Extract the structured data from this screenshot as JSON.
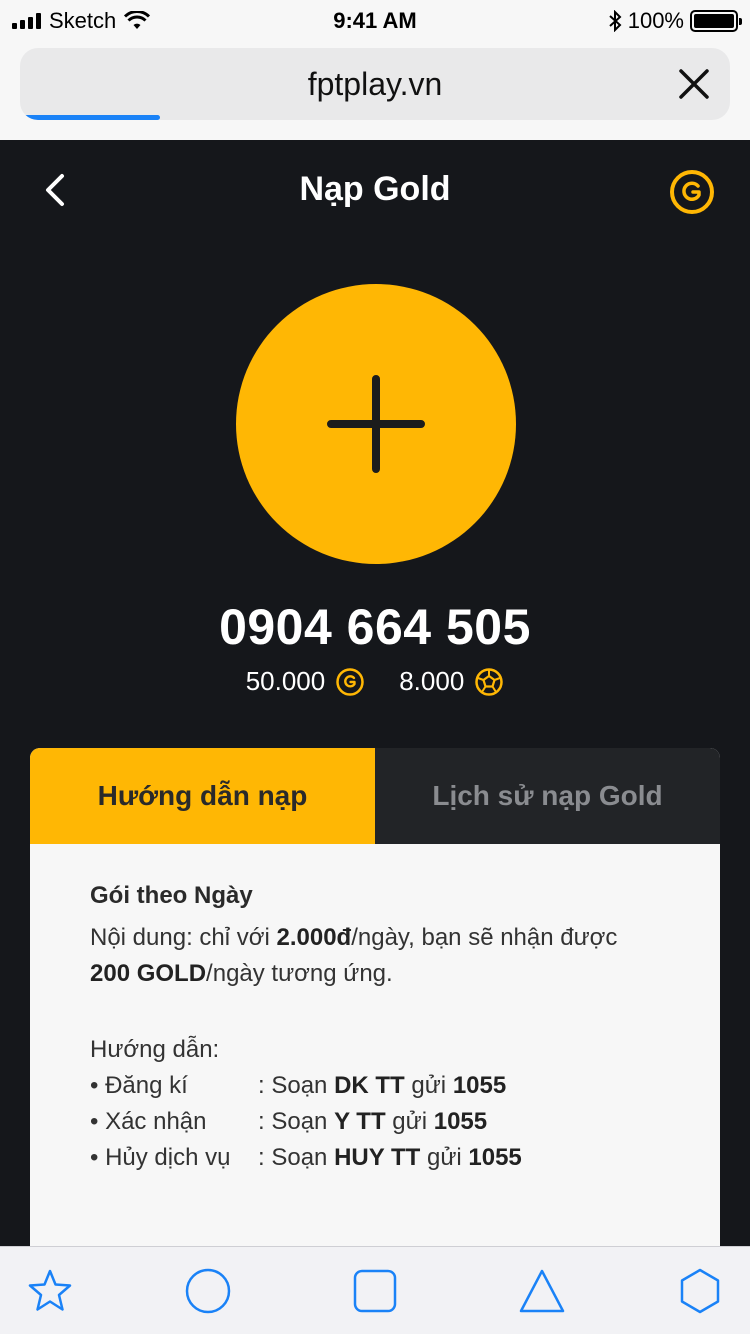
{
  "status_bar": {
    "carrier": "Sketch",
    "time": "9:41 AM",
    "battery": "100%"
  },
  "browser": {
    "url": "fptplay.vn"
  },
  "header": {
    "title": "Nạp Gold"
  },
  "account": {
    "phone": "0904 664 505",
    "gold_balance": "50.000",
    "ball_balance": "8.000"
  },
  "tabs": [
    {
      "label": "Hướng dẫn nạp",
      "active": true
    },
    {
      "label": "Lịch sử nạp Gold",
      "active": false
    }
  ],
  "guide": {
    "package_title": "Gói theo Ngày",
    "content_prefix": "Nội dung: chỉ với ",
    "price": "2.000đ",
    "content_mid": "/ngày, bạn sẽ nhận được ",
    "gold_amount": "200 GOLD",
    "content_suffix": "/ngày tương ứng.",
    "instructions_label": "Hướng dẫn:",
    "steps": [
      {
        "label": "• Đăng kí",
        "sep": ": Soạn ",
        "code": "DK TT",
        "mid": " gửi ",
        "number": "1055"
      },
      {
        "label": "• Xác nhận",
        "sep": ": Soạn ",
        "code": "Y TT",
        "mid": " gửi ",
        "number": "1055"
      },
      {
        "label": "• Hủy dịch vụ",
        "sep": ": Soạn ",
        "code": "HUY TT",
        "mid": " gửi ",
        "number": "1055"
      }
    ]
  },
  "colors": {
    "accent": "#ffb704",
    "background": "#15171b",
    "ios_blue": "#1a82f7"
  }
}
